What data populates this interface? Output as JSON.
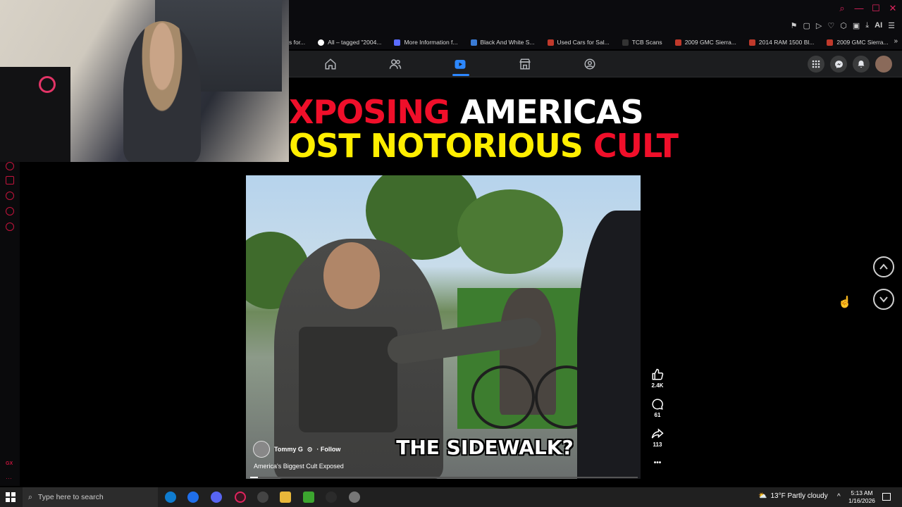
{
  "browser": {
    "bookmarks": [
      {
        "label": "s for...",
        "icon": "generic-favicon"
      },
      {
        "label": "All – tagged \"2004...",
        "icon": "tag-favicon"
      },
      {
        "label": "More Information f...",
        "icon": "info-favicon"
      },
      {
        "label": "Black And White S...",
        "icon": "site-favicon"
      },
      {
        "label": "Used Cars for Sal...",
        "icon": "car-favicon"
      },
      {
        "label": "TCB Scans",
        "icon": "manga-favicon"
      },
      {
        "label": "2009 GMC Sierra...",
        "icon": "car-favicon"
      },
      {
        "label": "2014 RAM 1500 Bl...",
        "icon": "car-favicon"
      },
      {
        "label": "2009 GMC Sierra...",
        "icon": "car-favicon"
      }
    ],
    "ai_label": "AI",
    "accent_color": "#e0245e"
  },
  "facebook_nav": {
    "active_tab": "video",
    "tabs": [
      "home",
      "friends",
      "video",
      "marketplace",
      "groups"
    ],
    "accent_color": "#2d88ff"
  },
  "video": {
    "title_line1": [
      {
        "text": "XPOSING ",
        "color": "red"
      },
      {
        "text": "AMERICAS",
        "color": "white"
      }
    ],
    "title_line2": [
      {
        "text": "OST NOTORIOUS ",
        "color": "yellow"
      },
      {
        "text": "CULT",
        "color": "red"
      }
    ],
    "caption": "THE SIDEWALK?",
    "author": "Tommy G",
    "follow_label": "· Follow",
    "description": "America's Biggest Cult Exposed",
    "progress_fraction": 0.02
  },
  "actions": {
    "likes": "2.4K",
    "comments": "61",
    "shares": "113",
    "more": "•••"
  },
  "sidebar": {
    "gx_label": "GX",
    "more": "···"
  },
  "taskbar": {
    "search_placeholder": "Type here to search",
    "weather": "13°F  Partly cloudy",
    "time": "5:13 AM",
    "date": "1/16/2026"
  }
}
